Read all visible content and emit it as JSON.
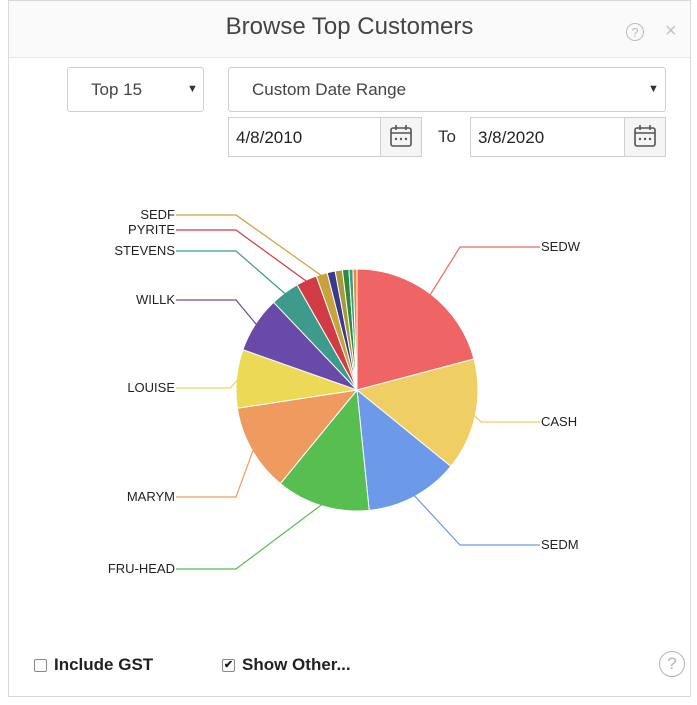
{
  "window": {
    "title": "Browse Top Customers",
    "help_icon": "question-circle-icon",
    "close_icon": "close-icon"
  },
  "filters": {
    "top_select": {
      "value": "Top 15",
      "options": [
        "Top 15"
      ]
    },
    "range_select": {
      "value": "Custom Date Range",
      "options": [
        "Custom Date Range"
      ]
    },
    "from_date": "4/8/2010",
    "to_label": "To",
    "to_date": "3/8/2020"
  },
  "chart_data": {
    "type": "pie",
    "slices": [
      {
        "label": "SEDW",
        "value": 19.5,
        "color": "#ef6464"
      },
      {
        "label": "CASH",
        "value": 14.0,
        "color": "#efcf63"
      },
      {
        "label": "SEDM",
        "value": 11.7,
        "color": "#6c9ae8"
      },
      {
        "label": "FRU-HEAD",
        "value": 11.7,
        "color": "#56bf50"
      },
      {
        "label": "MARYM",
        "value": 10.9,
        "color": "#ef9a5e"
      },
      {
        "label": "LOUISE",
        "value": 7.3,
        "color": "#ecd955"
      },
      {
        "label": "WILLK",
        "value": 7.0,
        "color": "#6a4aa8"
      },
      {
        "label": "STEVENS",
        "value": 3.6,
        "color": "#3e9a8a"
      },
      {
        "label": "PYRITE",
        "value": 2.6,
        "color": "#d13b45"
      },
      {
        "label": "SEDF",
        "value": 1.4,
        "color": "#c7a33c"
      },
      {
        "label": "",
        "value": 1.0,
        "color": "#3a3a8c"
      },
      {
        "label": "",
        "value": 0.9,
        "color": "#a89a3a"
      },
      {
        "label": "",
        "value": 0.8,
        "color": "#2e8a3a"
      },
      {
        "label": "",
        "value": 0.5,
        "color": "#3a9a8a"
      },
      {
        "label": "",
        "value": 0.5,
        "color": "#f08a30"
      }
    ]
  },
  "footer": {
    "include_gst": {
      "label": "Include GST",
      "checked": false
    },
    "show_other": {
      "label": "Show Other...",
      "checked": true
    },
    "help_icon": "question-circle-icon"
  }
}
